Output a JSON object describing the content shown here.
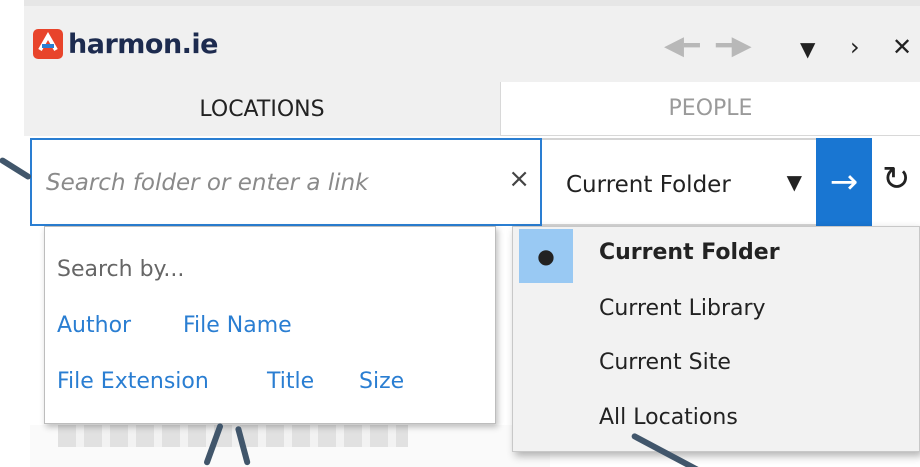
{
  "app": {
    "logo_text": "harmon.ie",
    "logo_colors": [
      "#e8442b",
      "#2a7ed2"
    ]
  },
  "titlebar": {
    "icons": [
      "back-arrow-icon",
      "forward-arrow-icon",
      "menu-caret-icon",
      "expand-icon",
      "close-icon"
    ]
  },
  "tabs": [
    {
      "label": "LOCATIONS",
      "active": true
    },
    {
      "label": "PEOPLE",
      "active": false
    }
  ],
  "search": {
    "placeholder": "Search folder or enter a link",
    "value": "",
    "clear_glyph": "×"
  },
  "scope": {
    "selected": "Current Folder",
    "options": [
      "Current Folder",
      "Current Library",
      "Current Site",
      "All Locations"
    ]
  },
  "go_button": {
    "glyph": "→"
  },
  "refresh": {
    "glyph": "↻"
  },
  "search_popup": {
    "heading": "Search by...",
    "fields": [
      "Author",
      "File Name",
      "File Extension",
      "Title",
      "Size"
    ]
  },
  "colors": {
    "accent": "#1976d2",
    "link": "#2a7ed2",
    "selected_item_bg": "#99c9f3",
    "pointer": "#41566b"
  }
}
